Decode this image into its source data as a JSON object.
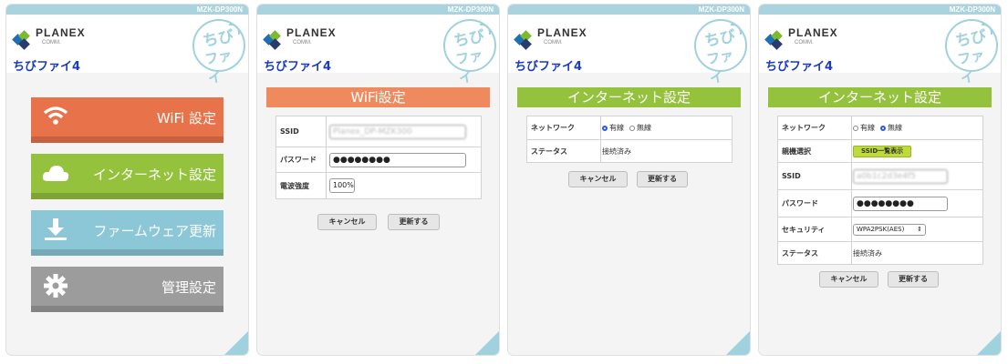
{
  "common": {
    "model": "MZK-DP300N",
    "brand": "PLANEX",
    "brand_sub": "COMM.",
    "product": "ちびファイ4",
    "chibi_line1": "ちび",
    "chibi_line2": "ファイ"
  },
  "menu": {
    "items": [
      {
        "label": "WiFi 設定",
        "icon": "wifi-icon",
        "color": "#e8734a"
      },
      {
        "label": "インターネット設定",
        "icon": "cloud-icon",
        "color": "#95c23d"
      },
      {
        "label": "ファームウェア更新",
        "icon": "download-icon",
        "color": "#8bc7d6"
      },
      {
        "label": "管理設定",
        "icon": "gear-icon",
        "color": "#9c9c9c"
      }
    ]
  },
  "wifi": {
    "title": "WiFi設定",
    "ssid_label": "SSID",
    "ssid_value": "Planex_DP-MZK300",
    "password_label": "パスワード",
    "password_value": "●●●●●●●●",
    "strength_label": "電波強度",
    "strength_value": "100%"
  },
  "internet_wired": {
    "title": "インターネット設定",
    "network_label": "ネットワーク",
    "opt_wired": "有線",
    "opt_wireless": "無線",
    "status_label": "ステータス",
    "status_value": "接続済み"
  },
  "internet_wireless": {
    "title": "インターネット設定",
    "network_label": "ネットワーク",
    "opt_wired": "有線",
    "opt_wireless": "無線",
    "parent_label": "親機選択",
    "ssid_list_button": "SSID一覧表示",
    "ssid_label": "SSID",
    "ssid_value": "a0b1c2d3e4f5",
    "password_label": "パスワード",
    "password_value": "●●●●●●●●",
    "security_label": "セキュリティ",
    "security_value": "WPA2PSK(AES)",
    "status_label": "ステータス",
    "status_value": "接続済み"
  },
  "buttons": {
    "cancel": "キャンセル",
    "update": "更新する"
  }
}
